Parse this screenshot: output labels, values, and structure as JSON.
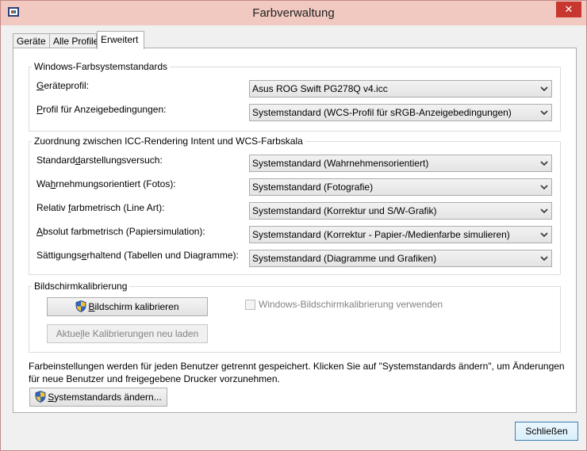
{
  "window": {
    "title": "Farbverwaltung",
    "close_glyph": "✕"
  },
  "tabs": [
    {
      "label": "Geräte"
    },
    {
      "label": "Alle Profile"
    },
    {
      "label": "Erweitert",
      "active": true
    }
  ],
  "windows_standards": {
    "legend": "Windows-Farbsystemstandards",
    "device_profile": {
      "label_accel": "G",
      "label_rest": "eräteprofil:",
      "value": "Asus ROG Swift PG278Q v4.icc"
    },
    "viewing_profile": {
      "label_accel": "P",
      "label_rest": "rofil für Anzeigebedingungen:",
      "value": "Systemstandard (WCS-Profil für sRGB-Anzeigebedingungen)"
    }
  },
  "rendering_intent": {
    "legend": "Zuordnung zwischen ICC-Rendering Intent und WCS-Farbskala",
    "rows": [
      {
        "label_pre": "Standard",
        "label_accel": "d",
        "label_post": "arstellungsversuch:",
        "value": "Systemstandard (Wahrnehmensorientiert)"
      },
      {
        "label_pre": "Wa",
        "label_accel": "h",
        "label_post": "rnehmungsorientiert (Fotos):",
        "value": "Systemstandard (Fotografie)"
      },
      {
        "label_pre": "Relativ ",
        "label_accel": "f",
        "label_post": "arbmetrisch (Line Art):",
        "value": "Systemstandard (Korrektur und S/W-Grafik)"
      },
      {
        "label_pre": "",
        "label_accel": "A",
        "label_post": "bsolut farbmetrisch (Papiersimulation):",
        "value": "Systemstandard (Korrektur - Papier-/Medienfarbe simulieren)"
      },
      {
        "label_pre": "Sättigungs",
        "label_accel": "e",
        "label_post": "rhaltend (Tabellen und Diagramme):",
        "value": "Systemstandard (Diagramme und Grafiken)"
      }
    ]
  },
  "calibration": {
    "legend": "Bildschirmkalibrierung",
    "calibrate_button": {
      "accel": "B",
      "rest": "ildschirm kalibrieren"
    },
    "reload_button": {
      "pre": "Aktue",
      "accel": "l",
      "post": "le Kalibrierungen neu laden"
    },
    "use_windows_calibration": {
      "label": "Windows-Bildschirmkalibrierung verwenden",
      "checked": false
    }
  },
  "footer_note": "Farbeinstellungen werden für jeden Benutzer getrennt gespeichert. Klicken Sie auf \"Systemstandards ändern\", um Änderungen für neue Benutzer und freigegebene Drucker vorzunehmen.",
  "change_defaults_button": {
    "accel": "S",
    "rest": "ystemstandards ändern..."
  },
  "close_button": "Schließen"
}
